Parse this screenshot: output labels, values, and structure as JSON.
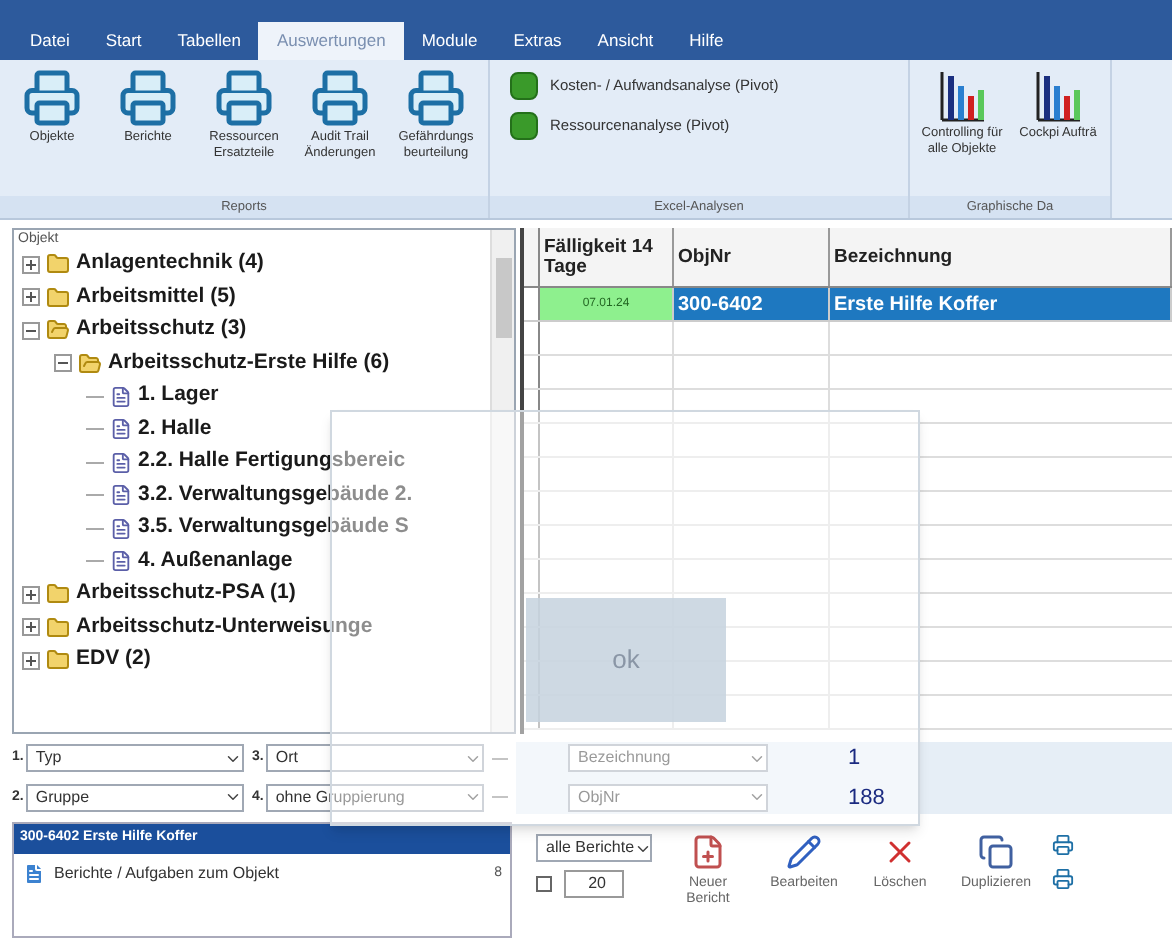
{
  "menu_tabs": [
    {
      "label": "Datei",
      "selected": false
    },
    {
      "label": "Start",
      "selected": false
    },
    {
      "label": "Tabellen",
      "selected": false
    },
    {
      "label": "Auswertungen",
      "selected": true
    },
    {
      "label": "Module",
      "selected": false
    },
    {
      "label": "Extras",
      "selected": false
    },
    {
      "label": "Ansicht",
      "selected": false
    },
    {
      "label": "Hilfe",
      "selected": false
    }
  ],
  "ribbon": {
    "groups": [
      {
        "label": "Reports",
        "kind": "printers",
        "buttons": [
          "Objekte",
          "Berichte",
          "Ressourcen Ersatzteile",
          "Audit Trail Änderungen",
          "Gefährdungs beurteilung"
        ]
      },
      {
        "label": "Excel-Analysen",
        "kind": "excel",
        "buttons": [
          "Kosten- / Aufwandsanalyse (Pivot)",
          "Ressourcenanalyse (Pivot)"
        ]
      },
      {
        "label": "Graphische Da",
        "kind": "charts",
        "buttons": [
          "Controlling für alle Objekte",
          "Cockpi Aufträ"
        ]
      }
    ]
  },
  "tree": {
    "header": "Objekt",
    "items": [
      {
        "label": "Anlagentechnik (4)",
        "kind": "folder",
        "expanded": false
      },
      {
        "label": "Arbeitsmittel (5)",
        "kind": "folder",
        "expanded": false
      },
      {
        "label": "Arbeitsschutz (3)",
        "kind": "folder",
        "expanded": true,
        "children": [
          {
            "label": "Arbeitsschutz-Erste Hilfe (6)",
            "kind": "folder",
            "expanded": true,
            "children": [
              {
                "label": "1. Lager",
                "kind": "doc"
              },
              {
                "label": "2. Halle",
                "kind": "doc"
              },
              {
                "label": "2.2. Halle Fertigungsbereic",
                "kind": "doc"
              },
              {
                "label": "3.2. Verwaltungsgebäude 2.",
                "kind": "doc"
              },
              {
                "label": "3.5. Verwaltungsgebäude S",
                "kind": "doc"
              },
              {
                "label": "4. Außenanlage",
                "kind": "doc"
              }
            ]
          }
        ]
      },
      {
        "label": "Arbeitsschutz-PSA (1)",
        "kind": "folder",
        "expanded": false
      },
      {
        "label": "Arbeitsschutz-Unterweisunge",
        "kind": "folder",
        "expanded": false
      },
      {
        "label": "EDV (2)",
        "kind": "folder",
        "expanded": false
      }
    ]
  },
  "grid": {
    "columns": [
      "Fälligkeit 14 Tage",
      "ObjNr",
      "Bezeichnung"
    ],
    "rows": [
      {
        "cells": [
          "07.01.24",
          "300-6402",
          "Erste Hilfe Koffer"
        ],
        "selected": true
      }
    ]
  },
  "grouping": [
    {
      "index": "1.",
      "value": "Typ"
    },
    {
      "index": "3.",
      "value": "Ort"
    },
    {
      "index": "2.",
      "value": "Gruppe"
    },
    {
      "index": "4.",
      "value": "ohne Gruppierung"
    }
  ],
  "sorting": [
    {
      "value": "Bezeichnung",
      "count": "1"
    },
    {
      "value": "ObjNr",
      "count": "188"
    }
  ],
  "object_panel": {
    "title": "300-6402 Erste Hilfe Koffer",
    "items": [
      {
        "label": "Berichte / Aufgaben zum Objekt",
        "count": "8"
      }
    ]
  },
  "reports_toolbar": {
    "filter": "alle Berichte",
    "checked": false,
    "page_size": "20",
    "buttons": [
      "Neuer Bericht",
      "Bearbeiten",
      "Löschen",
      "Duplizieren"
    ]
  },
  "dialog": {
    "button": "ok"
  }
}
